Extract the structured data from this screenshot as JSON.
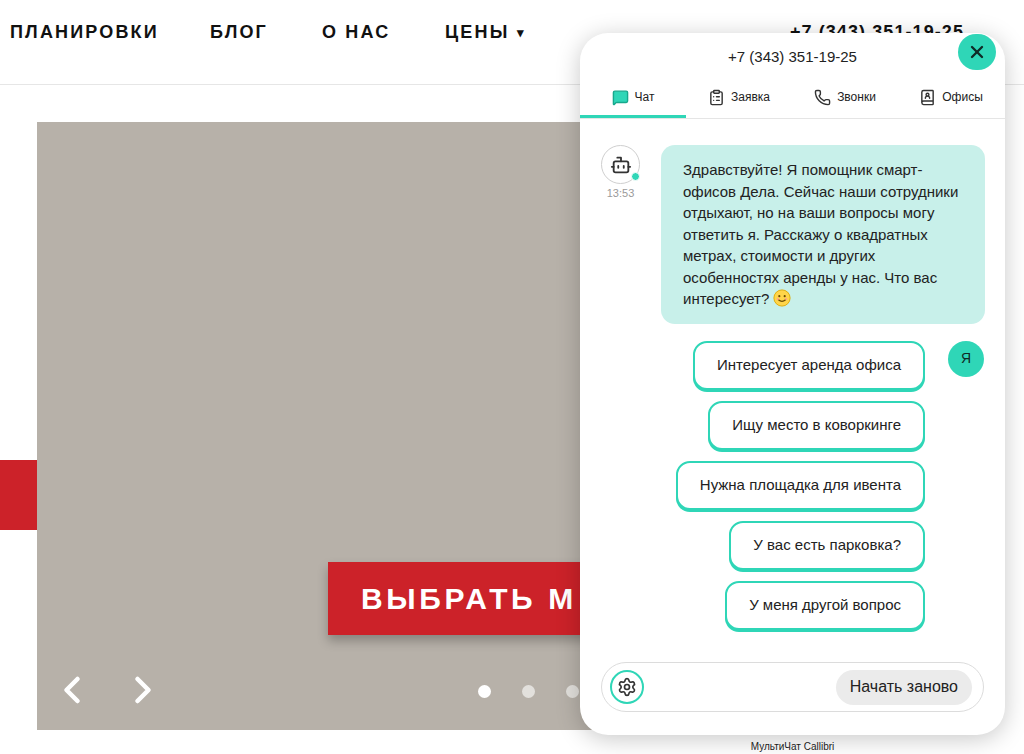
{
  "header": {
    "nav": [
      {
        "label": "ПЛАНИРОВКИ"
      },
      {
        "label": "БЛОГ"
      },
      {
        "label": "О НАС"
      },
      {
        "label": "ЦЕНЫ",
        "caret": "▾"
      }
    ],
    "phone": "+7 (343) 351-19-25"
  },
  "hero": {
    "button": "ВЫБРАТЬ М",
    "dots": [
      {
        "selected": true
      },
      {
        "selected": false
      },
      {
        "selected": false
      }
    ]
  },
  "chat": {
    "phone": "+7 (343) 351-19-25",
    "tabs": [
      {
        "label": "Чат",
        "selected": true
      },
      {
        "label": "Заявка",
        "selected": false
      },
      {
        "label": "Звонки",
        "selected": false
      },
      {
        "label": "Офисы",
        "selected": false
      }
    ],
    "bot_message": {
      "time": "13:53",
      "text": "Здравствуйте! Я помощник смарт-офисов Дела. Сейчас наши сотрудники отдыхают, но на ваши вопросы могу ответить я. Расскажу о квадратных метрах, стоимости и других особенностях аренды у нас. Что вас интересует?"
    },
    "user_avatar": "Я",
    "options": [
      "Интересует аренда офиса",
      "Ищу место в коворкинге",
      "Нужна площадка для ивента",
      "У вас есть парковка?",
      "У меня другой вопрос"
    ],
    "restart_button": "Начать заново"
  },
  "footer_brand": "МультиЧат Callibri"
}
